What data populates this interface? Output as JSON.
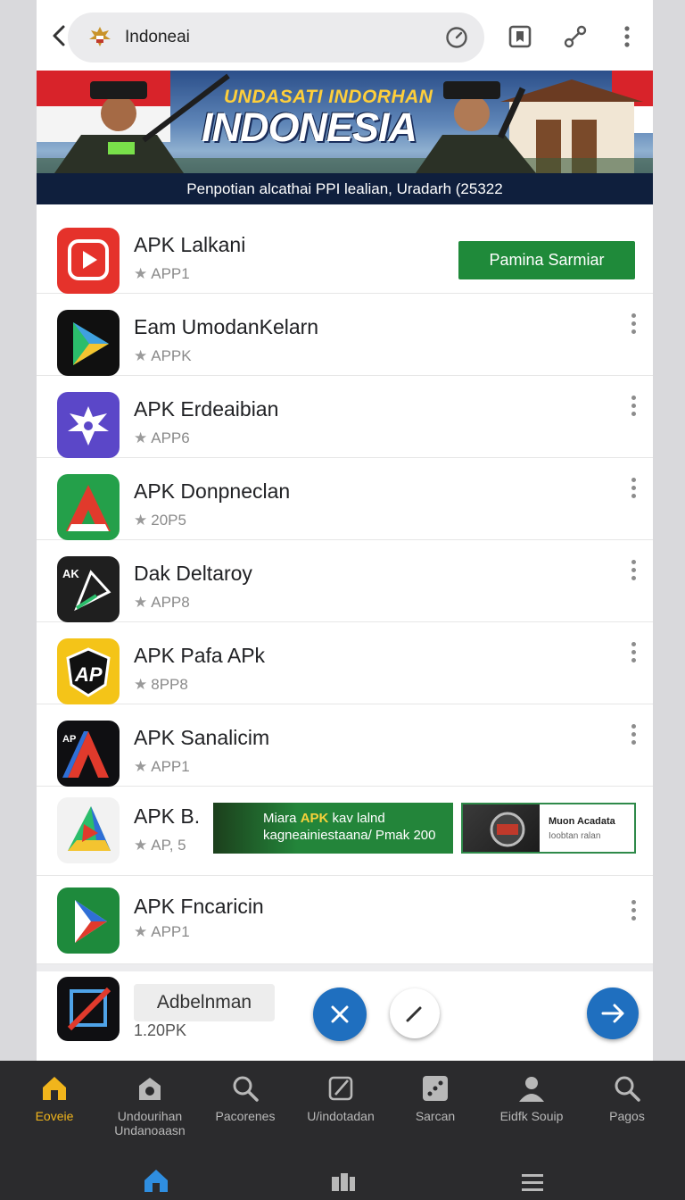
{
  "topbar": {
    "address_text": "Indoneai",
    "back_icon": "back-arrow-icon",
    "icons": [
      "speedometer-icon",
      "bookmark-icon",
      "share-icon",
      "more-vert-icon"
    ]
  },
  "banner": {
    "heading_small": "UNDASATI INDORHAN",
    "heading_large": "INDONESIA",
    "subtitle": "Penpotian alcathai PPI lealian, Uradarh (25322"
  },
  "apps": [
    {
      "name": "APK Lalkani",
      "meta": "APP1",
      "icon": "play-icon",
      "color": "#e5322b",
      "action": "Pamina Sarmiar"
    },
    {
      "name": "Eam UmodanKelarn",
      "meta": "APPK",
      "icon": "triangle-play-icon",
      "color": "#101010"
    },
    {
      "name": "APK Erdeaibian",
      "meta": "APP6",
      "icon": "garuda-emblem-icon",
      "color": "#5b47c8"
    },
    {
      "name": "APK Donpneclan",
      "meta": "20P5",
      "icon": "red-a-icon",
      "color": "#24a04a"
    },
    {
      "name": "Dak Deltaroy",
      "meta": "APP8",
      "icon": "dark-arrow-icon",
      "color": "#1f1f1f"
    },
    {
      "name": "APK Pafa APk",
      "meta": "8PP8",
      "icon": "ap-shield-icon",
      "color": "#f4c418"
    },
    {
      "name": "APK Sanalicim",
      "meta": "APP1",
      "icon": "red-blue-a-icon",
      "color": "#0f0f12"
    },
    {
      "name": "APK B.",
      "meta": "AP, 5",
      "icon": "colorful-triangle-icon",
      "color": "#f2f2f2",
      "ad1_prefix": "Miara ",
      "ad1_highlight": "APK",
      "ad1_suffix": " kav lalnd",
      "ad1_line2": "kagneainiestaana/ Pmak 200",
      "ad2_line1": "Muon Acadata",
      "ad2_line2": "Ioobtan ralan"
    },
    {
      "name": "APK Fncaricin",
      "meta": "APP1",
      "icon": "play-green-icon",
      "color": "#1e8a3c"
    }
  ],
  "bottom_sheet": {
    "chip_label": "Adbelnman",
    "meta": "1.20PK",
    "icon": "crossed-image-icon"
  },
  "nav": [
    {
      "label": "Eoveie",
      "icon": "home-icon",
      "active": true
    },
    {
      "label": "Undourihan Undanoaasn",
      "icon": "store-icon"
    },
    {
      "label": "Pacorenes",
      "icon": "search-icon"
    },
    {
      "label": "U/indotadan",
      "icon": "edit-icon"
    },
    {
      "label": "Sarcan",
      "icon": "dice-icon"
    },
    {
      "label": "Eidfk Souip",
      "icon": "person-icon"
    },
    {
      "label": "Pagos",
      "icon": "search-icon"
    }
  ],
  "system_nav": [
    "home-icon",
    "recents-icon",
    "menu-icon"
  ],
  "colors": {
    "accent": "#1f6fbf",
    "install": "#1f8a3a",
    "nav_active": "#f1b51c",
    "nav_bg": "#2b2b2d"
  }
}
